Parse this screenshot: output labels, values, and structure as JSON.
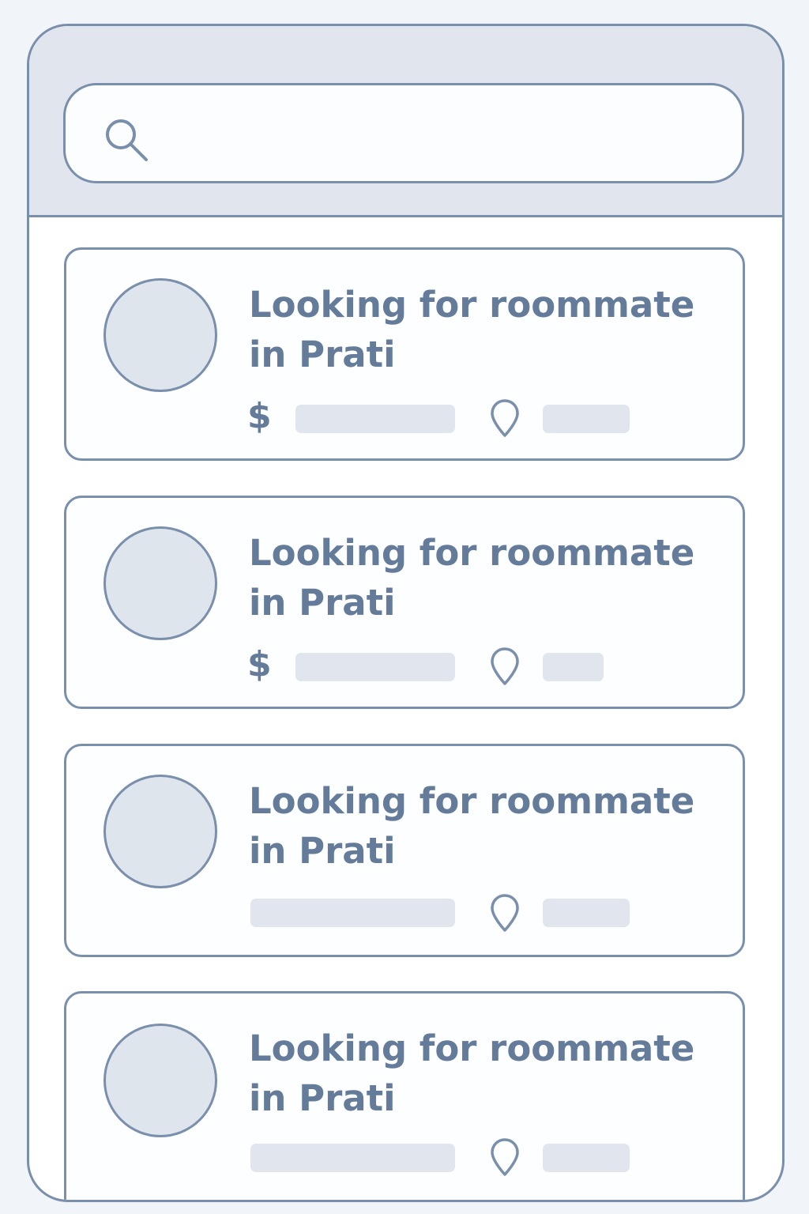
{
  "search": {
    "icon": "search-icon",
    "value": "",
    "placeholder": ""
  },
  "listings": [
    {
      "title": "Looking for roommate in Prati",
      "price_symbol": "$",
      "price_icon": "dollar-icon",
      "location_icon": "location-pin-icon",
      "price_value": "",
      "location_value": ""
    },
    {
      "title": "Looking for roommate in Prati",
      "price_symbol": "$",
      "price_icon": "dollar-icon",
      "location_icon": "location-pin-icon",
      "price_value": "",
      "location_value": ""
    },
    {
      "title": "Looking for roommate in Prati",
      "price_symbol": "",
      "price_icon": "",
      "location_icon": "location-pin-icon",
      "price_value": "",
      "location_value": ""
    },
    {
      "title": "Looking for roommate in Prati",
      "price_symbol": "",
      "price_icon": "",
      "location_icon": "location-pin-icon",
      "price_value": "",
      "location_value": ""
    }
  ],
  "colors": {
    "stroke": "#7a8fab",
    "text": "#647b9a",
    "placeholder_fill": "#e1e6ee",
    "header_bg": "#e1e6ee",
    "page_bg": "#f1f4f8"
  }
}
